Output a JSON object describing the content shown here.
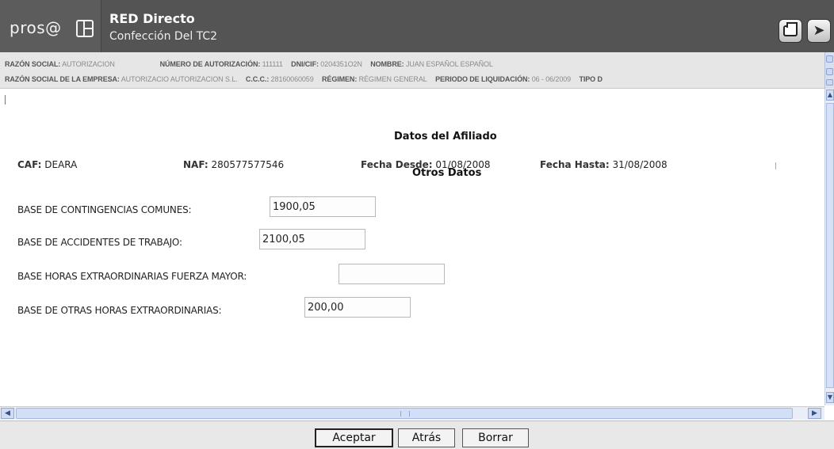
{
  "header": {
    "logo_text": "pros@",
    "title": "RED Directo",
    "subtitle": "Confección Del TC2"
  },
  "info_bar": {
    "line1": [
      {
        "label": "RAZÓN SOCIAL:",
        "value": "AUTORIZACION"
      },
      {
        "label": "NÚMERO DE AUTORIZACIÓN:",
        "value": "111111"
      },
      {
        "label": "DNI/CIF:",
        "value": "0204351O2N"
      },
      {
        "label": "NOMBRE:",
        "value": "JUAN ESPAÑOL ESPAÑOL"
      }
    ],
    "line2": [
      {
        "label": "RAZÓN SOCIAL DE LA EMPRESA:",
        "value": "AUTORIZACIO AUTORIZACION S.L."
      },
      {
        "label": "C.C.C.:",
        "value": "28160060059"
      },
      {
        "label": "RÉGIMEN:",
        "value": "RÉGIMEN GENERAL"
      },
      {
        "label": "PERIODO DE LIQUIDACIÓN:",
        "value": "06 - 06/2009"
      },
      {
        "label": "TIPO D",
        "value": ""
      }
    ]
  },
  "datos_afiliado": {
    "title": "Datos del Afiliado",
    "caf_label": "CAF:",
    "caf_value": "DEARA",
    "naf_label": "NAF:",
    "naf_value": "280577577546",
    "fecha_desde_label": "Fecha Desde:",
    "fecha_desde_value": "01/08/2008",
    "fecha_hasta_label": "Fecha Hasta:",
    "fecha_hasta_value": "31/08/2008"
  },
  "otros_datos": {
    "title": "Otros Datos",
    "fields": [
      {
        "label": "BASE DE CONTINGENCIAS COMUNES:",
        "value": "1900,05"
      },
      {
        "label": "BASE DE ACCIDENTES DE TRABAJO:",
        "value": "2100,05"
      },
      {
        "label": "BASE HORAS EXTRAORDINARIAS FUERZA MAYOR:",
        "value": ""
      },
      {
        "label": "BASE DE OTRAS HORAS EXTRAORDINARIAS:",
        "value": "200,00"
      }
    ]
  },
  "footer": {
    "aceptar": "Aceptar",
    "atras": "Atrás",
    "borrar": "Borrar"
  },
  "icons": {
    "print": "printer-icon",
    "exit": "exit-runner-icon",
    "logo": "prosa-logo-icon"
  }
}
